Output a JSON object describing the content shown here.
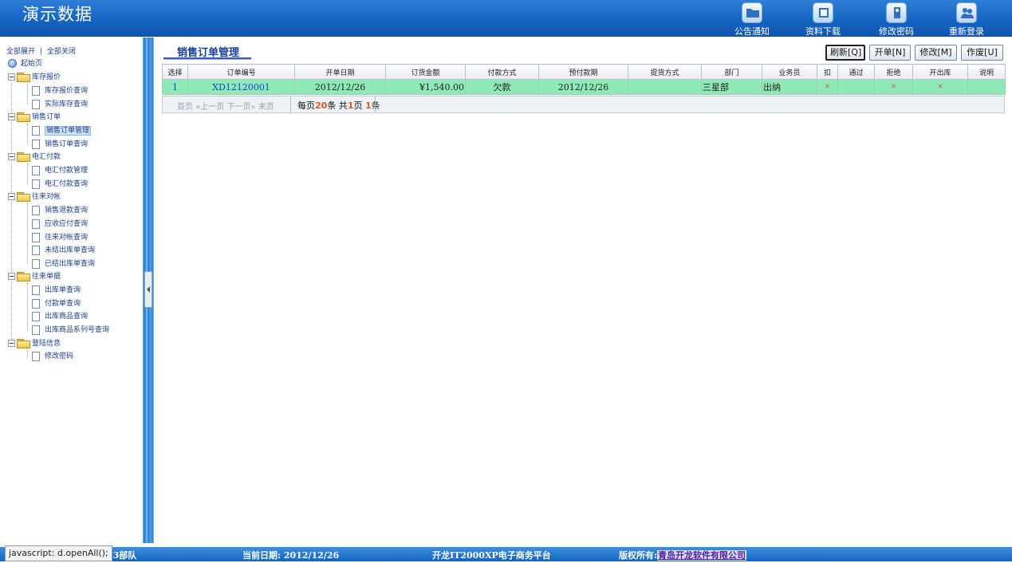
{
  "header": {
    "title": "演示数据",
    "buttons": [
      {
        "label": "公告通知",
        "icon": "folder-icon"
      },
      {
        "label": "资料下载",
        "icon": "download-icon"
      },
      {
        "label": "修改密码",
        "icon": "key-icon"
      },
      {
        "label": "重新登录",
        "icon": "users-icon"
      }
    ]
  },
  "tree": {
    "expand_all": "全部展开",
    "separator": "|",
    "collapse_all": "全部关闭",
    "root": "起始页",
    "groups": [
      {
        "label": "库存报价",
        "items": [
          "库存报价查询",
          "实际库存查询"
        ]
      },
      {
        "label": "销售订单",
        "items": [
          "销售订单管理",
          "销售订单查询"
        ]
      },
      {
        "label": "电汇付款",
        "items": [
          "电汇付款管理",
          "电汇付款查询"
        ]
      },
      {
        "label": "往来对帐",
        "items": [
          "销售退款查询",
          "应收应付查询",
          "往来对帐查询",
          "未结出库单查询",
          "已结出库单查询"
        ]
      },
      {
        "label": "往来单据",
        "items": [
          "出库单查询",
          "付款单查询",
          "出库商品查询",
          "出库商品系列号查询"
        ]
      },
      {
        "label": "登陆信息",
        "items": [
          "修改密码"
        ]
      }
    ],
    "selected": "销售订单管理"
  },
  "main": {
    "title": "销售订单管理",
    "actions": [
      {
        "label": "刷新[Q]"
      },
      {
        "label": "开单[N]"
      },
      {
        "label": "修改[M]"
      },
      {
        "label": "作废[U]"
      }
    ],
    "columns": [
      "选择",
      "订单编号",
      "开单日期",
      "订货金额",
      "付款方式",
      "预付款期",
      "提货方式",
      "部门",
      "业务员",
      "扣",
      "通过",
      "拒绝",
      "开出库",
      "说明"
    ],
    "rows": [
      {
        "select": "1",
        "order_no": "XD12120001",
        "open_date": "2012/12/26",
        "amount": "¥1,540.00",
        "payment": "欠款",
        "prepay_date": "2012/12/26",
        "delivery": "",
        "dept": "三星部",
        "salesman": "出纳",
        "deduct": "×",
        "pass": "",
        "reject": "×",
        "issue": "×",
        "note": ""
      }
    ],
    "pager": {
      "nav": "首页 «上一页 下一页» 末页",
      "prefix": "每页",
      "per_page": "20",
      "mid1": "条 共",
      "pages": "1",
      "mid2": "页 ",
      "total": "1",
      "suffix": "条"
    }
  },
  "footer": {
    "team": "43部队",
    "date": "当前日期: 2012/12/26",
    "platform": "开龙IT2000XP电子商务平台",
    "copyright_label": "版权所有:",
    "copyright_link": "青岛开龙软件有限公司",
    "status_tip": "javascript: d.openAll();"
  }
}
